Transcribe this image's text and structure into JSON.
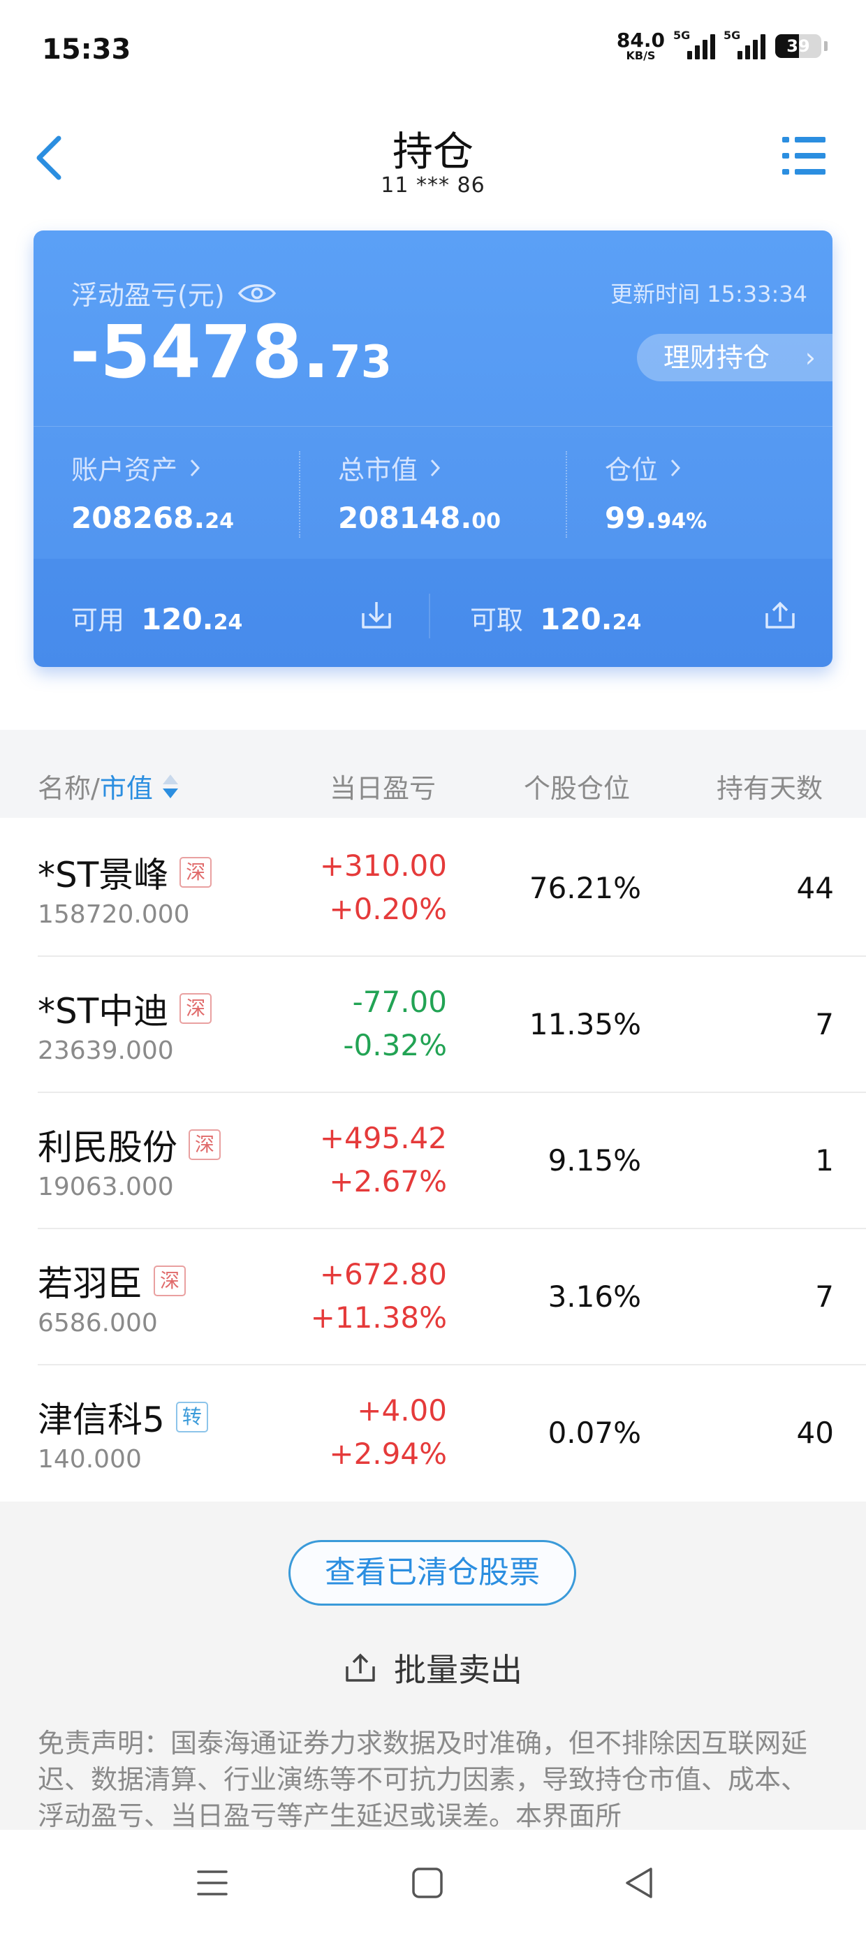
{
  "status_bar": {
    "time": "15:33",
    "net_speed_value": "84.0",
    "net_speed_unit": "KB/S",
    "signal1_label": "5G",
    "signal2_label": "5G",
    "battery": "39"
  },
  "header": {
    "title": "持仓",
    "account": "11 *** 86"
  },
  "summary": {
    "float_pnl_label": "浮动盈亏(元)",
    "float_pnl_int": "-5478.",
    "float_pnl_dec": "73",
    "update_time": "更新时间 15:33:34",
    "wealth_button": "理财持仓",
    "account_assets_label": "账户资产",
    "account_assets_int": "208268.",
    "account_assets_dec": "24",
    "market_value_label": "总市值",
    "market_value_int": "208148.",
    "market_value_dec": "00",
    "position_label": "仓位",
    "position_int": "99.",
    "position_dec": "94%",
    "available_label": "可用",
    "available_int": "120.",
    "available_dec": "24",
    "withdrawable_label": "可取",
    "withdrawable_int": "120.",
    "withdrawable_dec": "24"
  },
  "table": {
    "col_name": "名称/",
    "col_mv": "市值",
    "col_pnl": "当日盈亏",
    "col_pos": "个股仓位",
    "col_days": "持有天数",
    "rows": [
      {
        "name": "*ST景峰",
        "market": "深",
        "mv": "158720.000",
        "pnl": "+310.00",
        "pnl_pct": "+0.20%",
        "pos": "76.21%",
        "days": "44"
      },
      {
        "name": "*ST中迪",
        "market": "深",
        "mv": "23639.000",
        "pnl": "-77.00",
        "pnl_pct": "-0.32%",
        "pos": "11.35%",
        "days": "7"
      },
      {
        "name": "利民股份",
        "market": "深",
        "mv": "19063.000",
        "pnl": "+495.42",
        "pnl_pct": "+2.67%",
        "pos": "9.15%",
        "days": "1"
      },
      {
        "name": "若羽臣",
        "market": "深",
        "mv": "6586.000",
        "pnl": "+672.80",
        "pnl_pct": "+11.38%",
        "pos": "3.16%",
        "days": "7"
      },
      {
        "name": "津信科5",
        "market": "转",
        "mv": "140.000",
        "pnl": "+4.00",
        "pnl_pct": "+2.94%",
        "pos": "0.07%",
        "days": "40"
      }
    ]
  },
  "actions": {
    "cleared_button": "查看已清仓股票",
    "batch_sell": "批量卖出"
  },
  "disclaimer": "免责声明：国泰海通证券力求数据及时准确，但不排除因互联网延迟、数据清算、行业演练等不可抗力因素，导致持仓市值、成本、浮动盈亏、当日盈亏等产生延迟或误差。本界面所",
  "colors": {
    "card_blue": "#5ba0f6",
    "accent_blue": "#2b8ee0",
    "gain_red": "#e53a3a",
    "loss_green": "#22a354"
  }
}
